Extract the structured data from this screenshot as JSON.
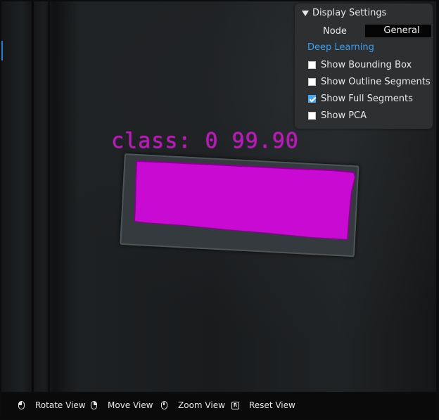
{
  "viewport": {
    "detection": {
      "label": "class: 0 99.90",
      "segment_color": "#c80ad2"
    }
  },
  "settings_panel": {
    "title": "Display Settings",
    "node_label": "Node",
    "node_value": "General",
    "section_title": "Deep Learning",
    "options": [
      {
        "label": "Show Bounding Box",
        "checked": false
      },
      {
        "label": "Show Outline Segments",
        "checked": false
      },
      {
        "label": "Show Full Segments",
        "checked": true
      },
      {
        "label": "Show PCA",
        "checked": false
      }
    ]
  },
  "status_bar": {
    "hints": [
      {
        "icon": "mouse-left-icon",
        "label": "Rotate View"
      },
      {
        "icon": "mouse-right-icon",
        "label": "Move View"
      },
      {
        "icon": "mouse-wheel-icon",
        "label": "Zoom View"
      },
      {
        "icon": "key-r-icon",
        "key": "R",
        "label": "Reset View"
      }
    ]
  },
  "colors": {
    "accent": "#3a9ef0",
    "panel_bg": "#2e2f30",
    "segment": "#c80ad2",
    "label": "#b11fb0"
  }
}
